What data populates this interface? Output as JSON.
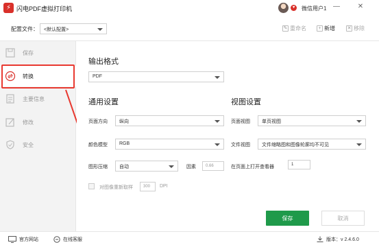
{
  "app": {
    "title": "闪电PDF虚拟打印机",
    "logo_glyph": "⚡",
    "accent": "#d9302a"
  },
  "user": {
    "name": "微信用户1",
    "vip_glyph": "♥"
  },
  "window": {
    "minimize": "—",
    "close": "✕"
  },
  "toolbar": {
    "config_label": "配置文件：",
    "config_value": "<默认配置>",
    "rename": "重命名",
    "add": "新增",
    "remove": "移除"
  },
  "sidebar": {
    "items": [
      {
        "label": "保存",
        "icon": "save-icon"
      },
      {
        "label": "转换",
        "icon": "convert-icon"
      },
      {
        "label": "主要信息",
        "icon": "document-icon"
      },
      {
        "label": "修改",
        "icon": "edit-icon"
      },
      {
        "label": "安全",
        "icon": "shield-icon"
      }
    ]
  },
  "output": {
    "title": "输出格式",
    "format": "PDF"
  },
  "general": {
    "title": "通用设置",
    "orientation_label": "页面方向",
    "orientation_value": "纵向",
    "color_label": "颜色模型",
    "color_value": "RGB",
    "compress_label": "图形压缩",
    "compress_value": "自动",
    "factor_label": "因素",
    "factor_value": "0.66",
    "resample_label": "对图像重新取样",
    "dpi_value": "300",
    "dpi_unit": "DPI"
  },
  "view": {
    "title": "视图设置",
    "page_view_label": "页面视图",
    "page_view_value": "单页视图",
    "doc_view_label": "文件视图",
    "doc_view_value": "文件缩略图和图像轮廓均不可见",
    "open_page_label": "在页面上打开查看器",
    "open_page_value": "1"
  },
  "actions": {
    "save": "保存",
    "cancel": "取消",
    "save_color": "#1f9a4a"
  },
  "status": {
    "website": "官方网站",
    "support": "在线客服",
    "version": "版本：v 2.4.6.0"
  },
  "annotation_color": "#e8382f"
}
